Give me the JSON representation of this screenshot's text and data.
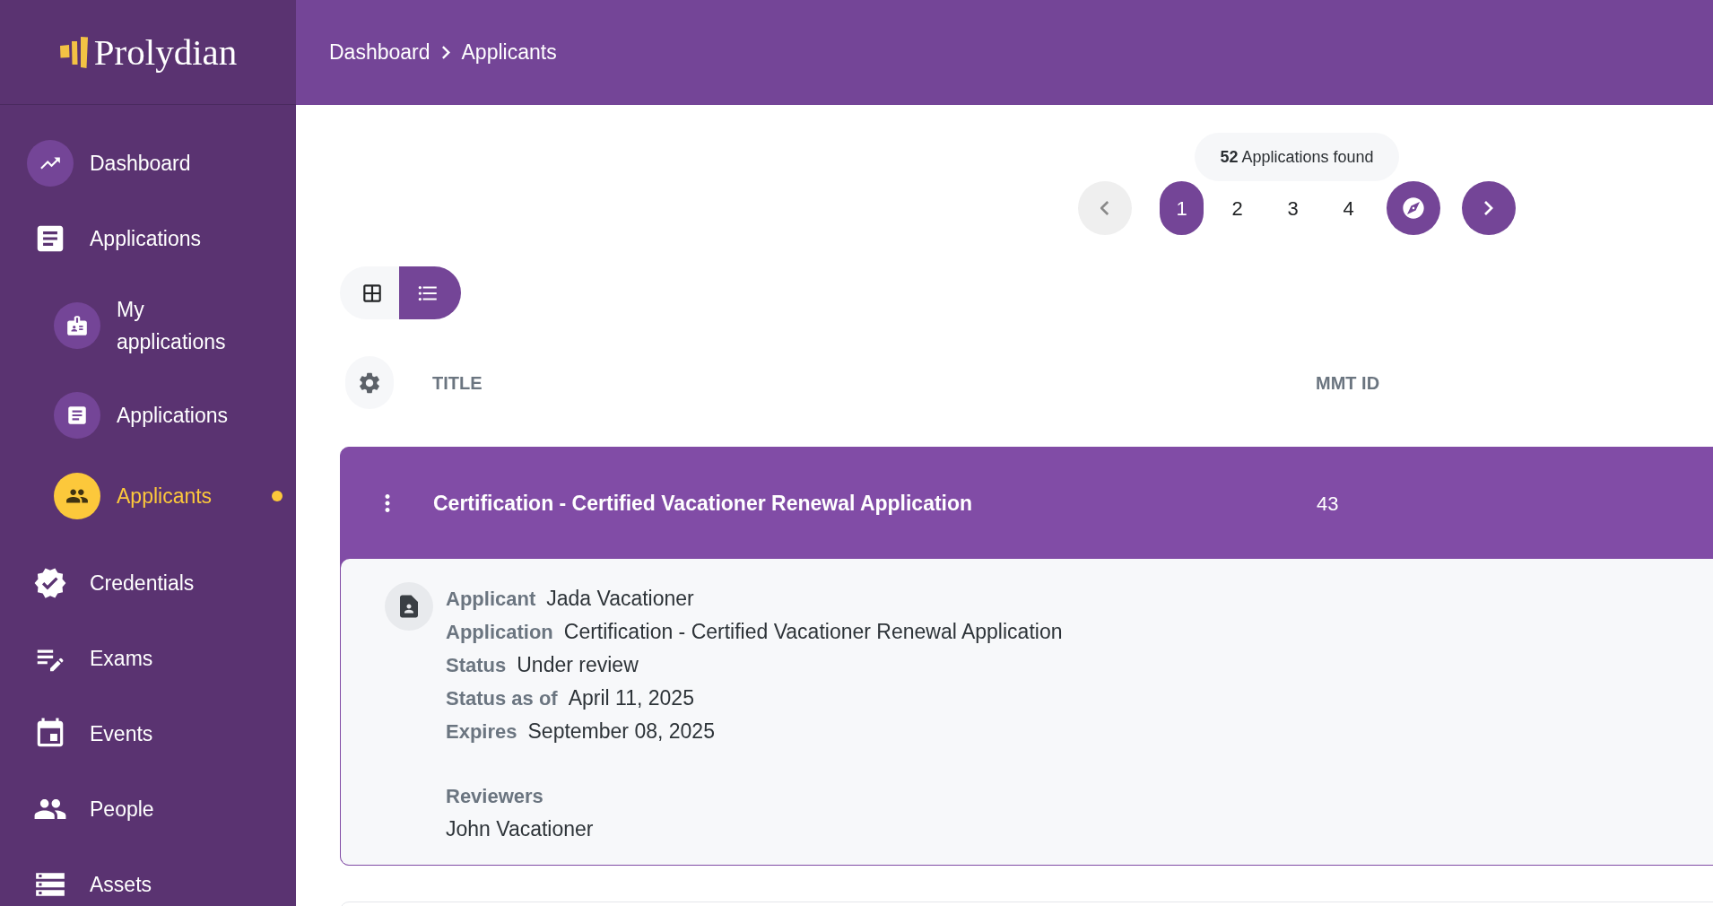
{
  "brand": {
    "name": "Prolydian"
  },
  "breadcrumb": [
    "Dashboard",
    "Applicants"
  ],
  "sidebar": {
    "items": [
      {
        "label": "Dashboard",
        "kind": "round",
        "selected": false
      },
      {
        "label": "Applications",
        "kind": "plain",
        "selected": false,
        "children": [
          {
            "label": "My applications",
            "selected": false
          },
          {
            "label": "Applications",
            "selected": false
          },
          {
            "label": "Applicants",
            "selected": true
          }
        ]
      },
      {
        "label": "Credentials",
        "kind": "plain",
        "selected": false
      },
      {
        "label": "Exams",
        "kind": "plain",
        "selected": false
      },
      {
        "label": "Events",
        "kind": "plain",
        "selected": false
      },
      {
        "label": "People",
        "kind": "plain",
        "selected": false
      },
      {
        "label": "Assets",
        "kind": "plain",
        "selected": false
      }
    ]
  },
  "pagination": {
    "results": "**52** Applications found",
    "previous": {
      "disabled": true
    },
    "pages": [
      {
        "label": "1",
        "selected": true
      },
      {
        "label": "2",
        "selected": false
      },
      {
        "label": "3",
        "selected": false
      },
      {
        "label": "4",
        "selected": false
      }
    ],
    "next": {
      "disabled": false
    }
  },
  "view_toggle": [
    {
      "kind": "grid",
      "selected": false
    },
    {
      "kind": "list",
      "selected": true
    }
  ],
  "table": {
    "columns": [
      "TITLE",
      "MMT ID"
    ],
    "rows": [
      {
        "title": "Certification - Certified Vacationer Renewal Application",
        "mmt_id": "43",
        "expanded": true,
        "details": {
          "fields": [
            {
              "label": "Applicant",
              "value": "Jada Vacationer"
            },
            {
              "label": "Application",
              "value": "Certification - Certified Vacationer Renewal Application"
            },
            {
              "label": "Status",
              "value": "Under review"
            },
            {
              "label": "Status as of",
              "value": "April 11, 2025"
            },
            {
              "label": "Expires",
              "value": "September 08, 2025"
            }
          ],
          "reviewers_label": "Reviewers",
          "reviewers": [
            "John Vacationer"
          ]
        }
      }
    ]
  }
}
